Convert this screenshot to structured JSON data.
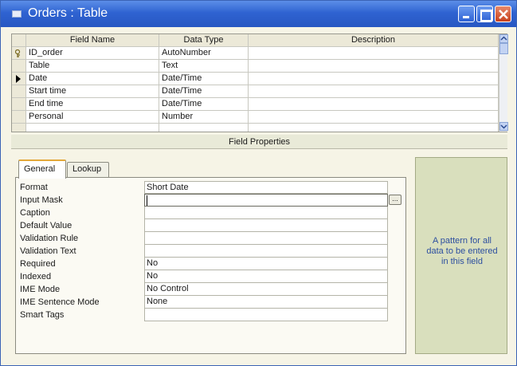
{
  "window": {
    "title": "Orders : Table"
  },
  "grid": {
    "headers": {
      "field_name": "Field Name",
      "data_type": "Data Type",
      "description": "Description"
    },
    "rows": [
      {
        "name": "ID_order",
        "type": "AutoNumber",
        "description": "",
        "marker": "key"
      },
      {
        "name": "Table",
        "type": "Text",
        "description": "",
        "marker": ""
      },
      {
        "name": "Date",
        "type": "Date/Time",
        "description": "",
        "marker": "current"
      },
      {
        "name": "Start time",
        "type": "Date/Time",
        "description": "",
        "marker": ""
      },
      {
        "name": "End time",
        "type": "Date/Time",
        "description": "",
        "marker": ""
      },
      {
        "name": "Personal",
        "type": "Number",
        "description": "",
        "marker": ""
      }
    ]
  },
  "field_properties": {
    "label": "Field Properties",
    "tabs": {
      "general": "General",
      "lookup": "Lookup"
    },
    "properties": [
      {
        "label": "Format",
        "value": "Short Date"
      },
      {
        "label": "Input Mask",
        "value": ""
      },
      {
        "label": "Caption",
        "value": ""
      },
      {
        "label": "Default Value",
        "value": ""
      },
      {
        "label": "Validation Rule",
        "value": ""
      },
      {
        "label": "Validation Text",
        "value": ""
      },
      {
        "label": "Required",
        "value": "No"
      },
      {
        "label": "Indexed",
        "value": "No"
      },
      {
        "label": "IME Mode",
        "value": "No Control"
      },
      {
        "label": "IME Sentence Mode",
        "value": "None"
      },
      {
        "label": "Smart Tags",
        "value": ""
      }
    ],
    "build_button": "...",
    "help_text": "A pattern for all data to be entered in this field"
  },
  "colors": {
    "titlebar": "#2f63d1",
    "help_text": "#2d4fa0",
    "help_panel": "#d9dfbd"
  },
  "icons": {
    "key": "key-icon",
    "current": "record-selector-arrow-icon"
  }
}
